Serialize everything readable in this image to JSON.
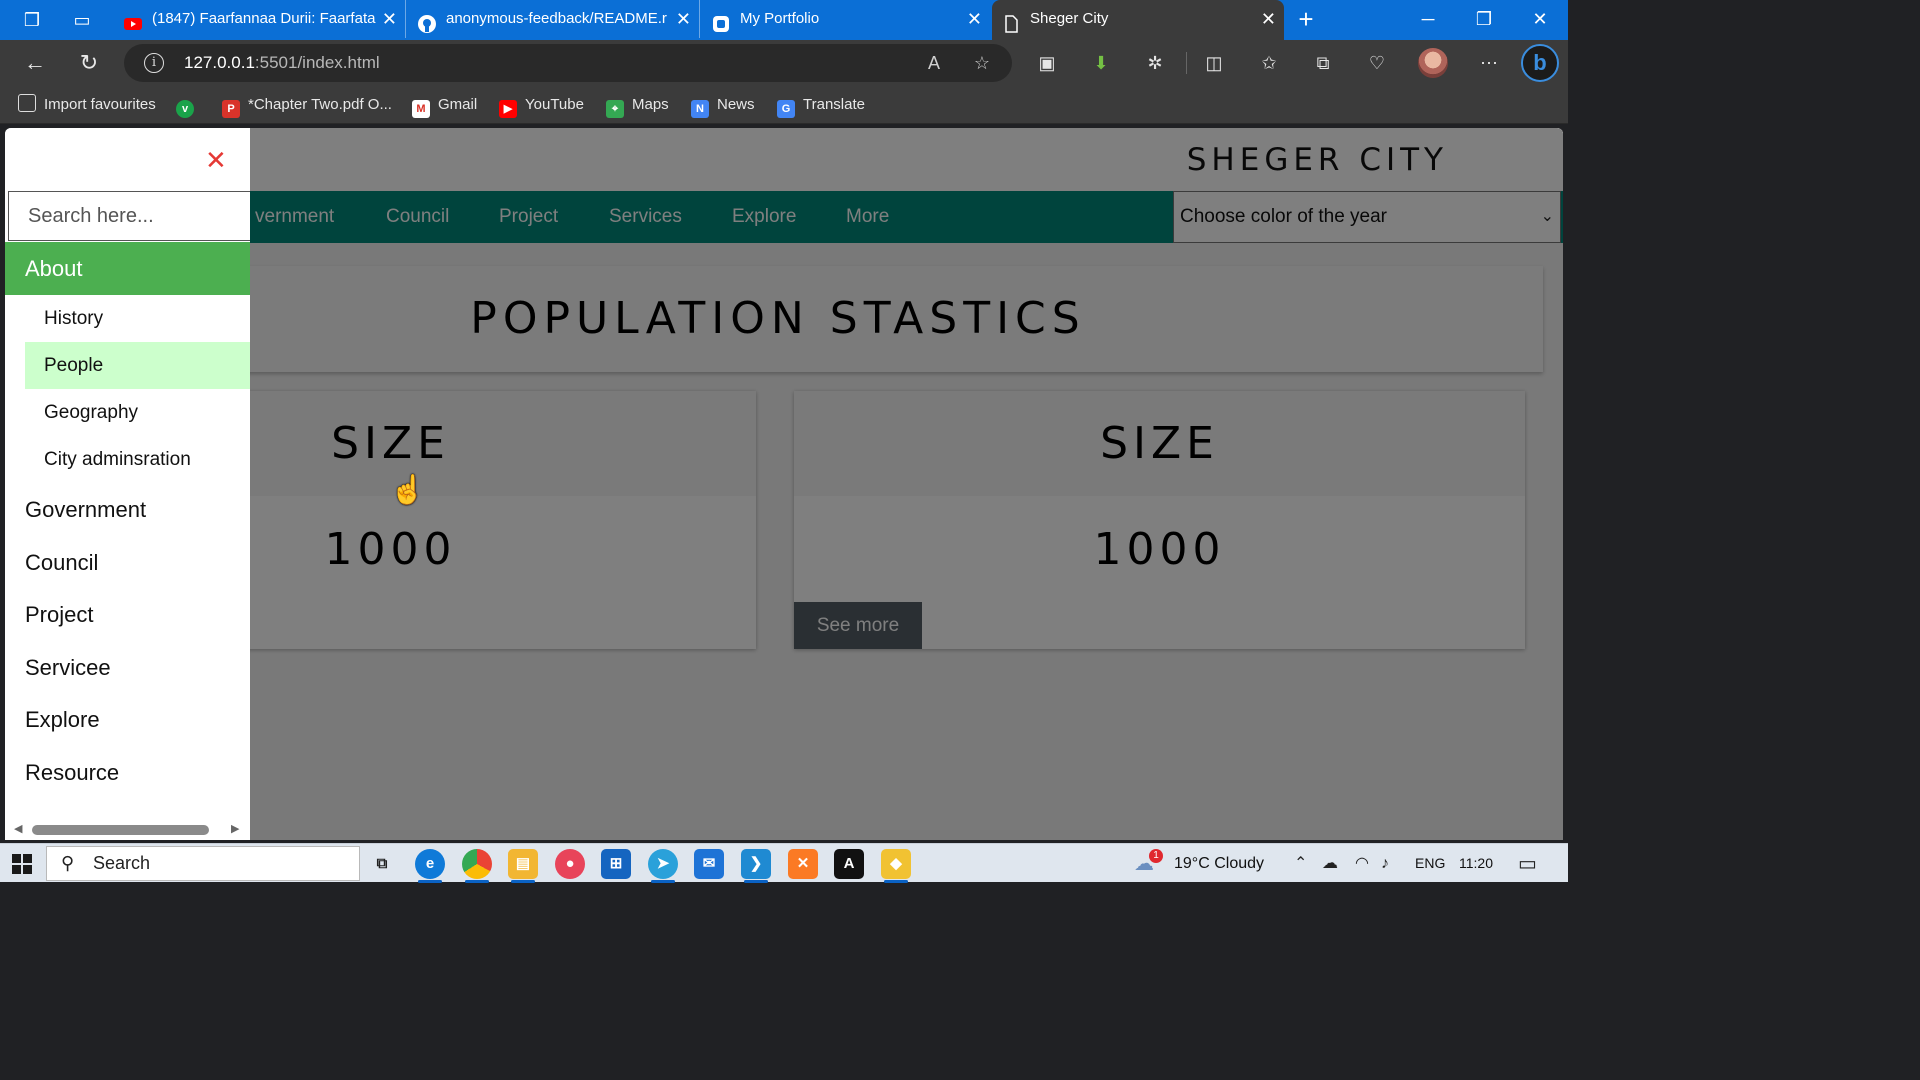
{
  "browser": {
    "tabs": [
      {
        "title": "(1847) Faarfannaa Durii: Faarfata",
        "icon": "youtube-icon"
      },
      {
        "title": "anonymous-feedback/README.r",
        "icon": "github-icon"
      },
      {
        "title": "My Portfolio",
        "icon": "portfolio-icon"
      },
      {
        "title": "Sheger City",
        "icon": "page-icon",
        "active": true
      }
    ],
    "address": {
      "host": "127.0.0.1",
      "path": ":5501/index.html"
    },
    "favourites": [
      {
        "label": "Import favourites",
        "icon": "import-icon"
      },
      {
        "label": "",
        "icon": "vimeo-icon"
      },
      {
        "label": "*Chapter Two.pdf O...",
        "icon": "pdf-icon"
      },
      {
        "label": "Gmail",
        "icon": "gmail-icon"
      },
      {
        "label": "YouTube",
        "icon": "youtube-icon"
      },
      {
        "label": "Maps",
        "icon": "maps-icon"
      },
      {
        "label": "News",
        "icon": "news-icon"
      },
      {
        "label": "Translate",
        "icon": "translate-icon"
      }
    ]
  },
  "site": {
    "title": "SHEGER CITY",
    "nav": [
      "vernment",
      "Council",
      "Project",
      "Services",
      "Explore",
      "More"
    ],
    "color_select": "Choose color of the year",
    "section_title": "POPULATION STASTICS",
    "cards": [
      {
        "label": "SIZE",
        "value": "1000"
      },
      {
        "label": "SIZE",
        "value": "1000",
        "button": "See more"
      }
    ]
  },
  "drawer": {
    "search_placeholder": "Search here...",
    "active": "About",
    "sub_items": [
      "History",
      "People",
      "Geography",
      "City adminsration"
    ],
    "highlighted_sub": "People",
    "items": [
      "Government",
      "Council",
      "Project",
      "Servicee",
      "Explore",
      "Resource"
    ]
  },
  "taskbar": {
    "search": "Search",
    "weather": {
      "temp": "19°C",
      "condition": "Cloudy",
      "badge": "1"
    },
    "lang": "ENG",
    "time": "11:20"
  },
  "colors": {
    "tab_strip": "#0b6fd6",
    "nav_teal": "#00897b",
    "drawer_active": "#4caf50",
    "drawer_highlight": "#ccffcc",
    "close_red": "#e53935"
  }
}
